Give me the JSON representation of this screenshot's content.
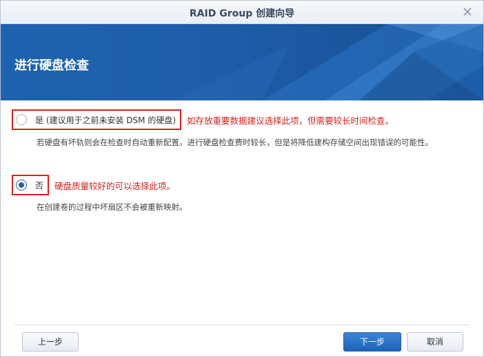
{
  "window": {
    "title": "RAID Group 创建向导"
  },
  "banner": {
    "title": "进行硬盘检查"
  },
  "options": [
    {
      "label": "是 (建议用于之前未安装 DSM 的硬盘)",
      "note": "如存放重要数据建议选择此项，但需要较长时间检查。",
      "description": "若硬盘有坏轨则会在检查时自动重新配置。进行硬盘检查费时较长，但是将降低建构存储空间出现错误的可能性。",
      "checked": false
    },
    {
      "label": "否",
      "note": "硬盘质量较好的可以选择此项。",
      "description": "在创建卷的过程中坏扇区不会被重新映射。",
      "checked": true
    }
  ],
  "footer": {
    "back_label": "上一步",
    "next_label": "下一步",
    "cancel_label": "取消"
  },
  "colors": {
    "banner_blue": "#1e63b0",
    "annotation_red": "#d9201c",
    "primary_button": "#2569bd"
  }
}
